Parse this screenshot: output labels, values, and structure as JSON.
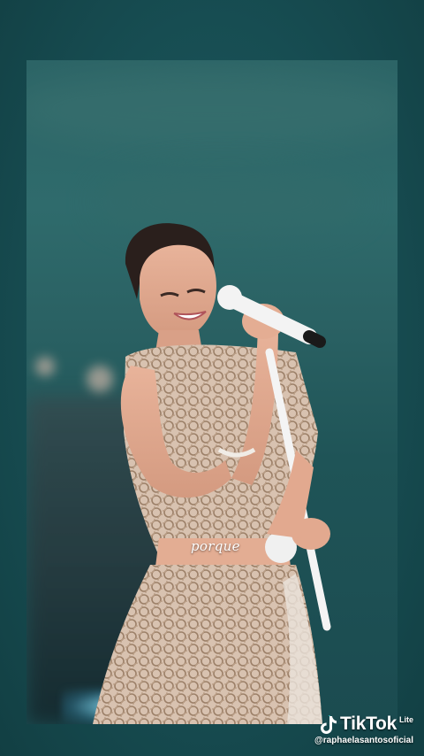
{
  "video": {
    "caption": "porque",
    "description": "Singer in sequined dress performing with microphone on stage"
  },
  "watermark": {
    "brand": "TikTok",
    "edition": "Lite",
    "handle": "@raphaelasantosoficial",
    "icon": "tiktok-note-icon"
  },
  "colors": {
    "background": "#14484c",
    "sky": "#2c6466",
    "watermark_text": "#ffffff"
  }
}
